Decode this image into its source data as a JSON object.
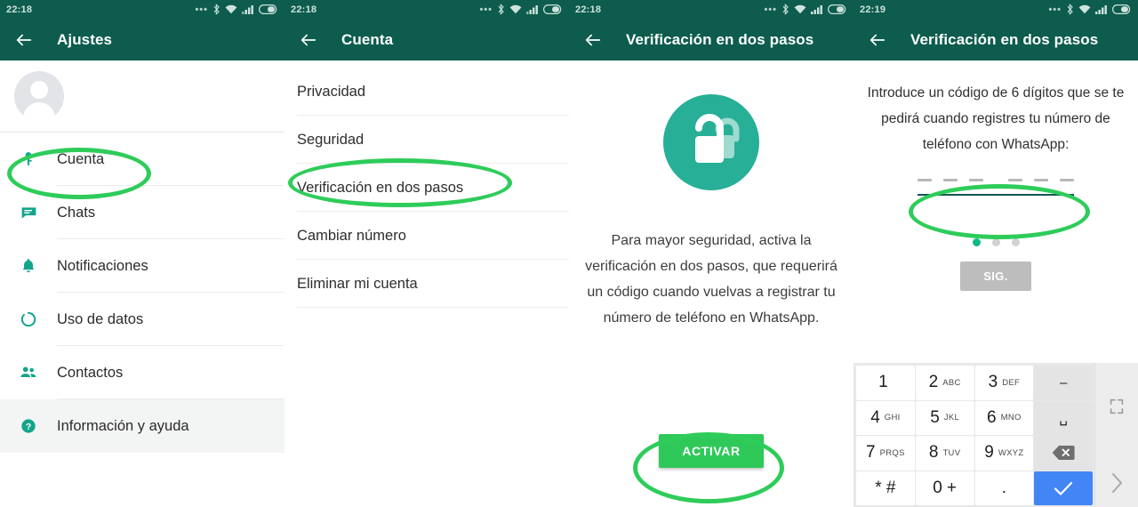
{
  "accent": {
    "header_green": "#0d5c4d",
    "teal": "#12a58b",
    "bright_green": "#2ecc5a",
    "annotation": "#2ecc5a",
    "key_blue": "#4285f4"
  },
  "panels": [
    {
      "name": "settings-drawer",
      "status": {
        "time": "22:18",
        "icons": [
          "more-icon",
          "bluetooth-icon",
          "wifi-icon",
          "signal-icon",
          "battery-icon"
        ]
      },
      "appbar": {
        "back": "back-arrow-icon",
        "title": "Ajustes"
      },
      "avatar": "avatar-placeholder",
      "items": [
        {
          "label": "Cuenta",
          "icon": "key-icon",
          "active": false,
          "highlighted": true
        },
        {
          "label": "Chats",
          "icon": "chat-icon",
          "active": false,
          "highlighted": false
        },
        {
          "label": "Notificaciones",
          "icon": "bell-icon",
          "active": false,
          "highlighted": false
        },
        {
          "label": "Uso de datos",
          "icon": "data-usage-icon",
          "active": false,
          "highlighted": false
        },
        {
          "label": "Contactos",
          "icon": "contacts-icon",
          "active": false,
          "highlighted": false
        },
        {
          "label": "Información y ayuda",
          "icon": "help-icon",
          "active": true,
          "highlighted": false
        }
      ]
    },
    {
      "name": "account-settings",
      "status": {
        "time": "22:18"
      },
      "appbar": {
        "back": "back-arrow-icon",
        "title": "Cuenta"
      },
      "rows": [
        {
          "label": "Privacidad"
        },
        {
          "label": "Seguridad"
        },
        {
          "label": "Verificación en dos pasos"
        },
        {
          "label": "Cambiar número"
        },
        {
          "label": "Eliminar mi cuenta"
        }
      ]
    },
    {
      "name": "two-step-intro",
      "status": {
        "time": "22:18"
      },
      "appbar": {
        "back": "back-arrow-icon",
        "title": "Verificación en dos pasos"
      },
      "hero_icon": "double-lock-icon",
      "description": "Para mayor seguridad, activa la verificación en dos pasos, que requerirá un código cuando vuelvas a registrar tu número de teléfono en WhatsApp.",
      "activate_label": "ACTIVAR"
    },
    {
      "name": "two-step-code-entry",
      "status": {
        "time": "22:19"
      },
      "appbar": {
        "back": "back-arrow-icon",
        "title": "Verificación en dos pasos"
      },
      "description": "Introduce un código de 6 dígitos que se te pedirá cuando registres tu número de teléfono con WhatsApp:",
      "code_value": "",
      "code_digits": 6,
      "pager": {
        "total": 3,
        "active_index": 0
      },
      "next_label": "SIG.",
      "keypad": {
        "rows": [
          [
            {
              "num": "1",
              "sub": ""
            },
            {
              "num": "2",
              "sub": "ABC"
            },
            {
              "num": "3",
              "sub": "DEF"
            },
            {
              "sym": "–",
              "fn": "dash-key"
            }
          ],
          [
            {
              "num": "4",
              "sub": "GHI"
            },
            {
              "num": "5",
              "sub": "JKL"
            },
            {
              "num": "6",
              "sub": "MNO"
            },
            {
              "sym": "␣",
              "fn": "space-key"
            }
          ],
          [
            {
              "num": "7",
              "sub": "PRQS"
            },
            {
              "num": "8",
              "sub": "TUV"
            },
            {
              "num": "9",
              "sub": "WXYZ"
            },
            {
              "sym": "⌫",
              "fn": "backspace-key"
            }
          ],
          [
            {
              "num": "* #",
              "sub": ""
            },
            {
              "num": "0",
              "sub": "+"
            },
            {
              "num": ".",
              "sub": ""
            },
            {
              "sym": "✓",
              "fn": "enter-key"
            }
          ]
        ],
        "side_icons": [
          "resize-icon",
          "chevron-right-icon"
        ]
      }
    }
  ]
}
